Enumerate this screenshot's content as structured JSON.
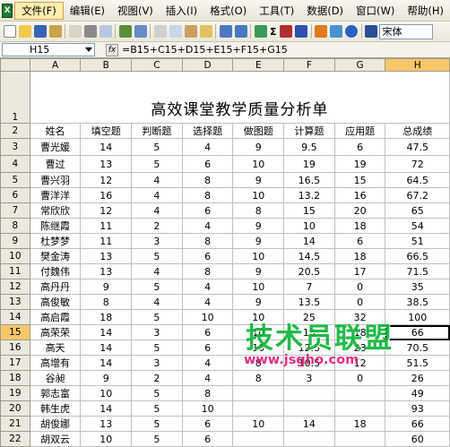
{
  "menubar": {
    "app_icon": "X",
    "items": [
      "文件(F)",
      "编辑(E)",
      "视图(V)",
      "插入(I)",
      "格式(O)",
      "工具(T)",
      "数据(D)",
      "窗口(W)",
      "帮助(H)"
    ]
  },
  "toolbar": {
    "sigma": "Σ",
    "font_name": "宋体",
    "icons": [
      "new-icon",
      "open-icon",
      "save-icon",
      "permission-icon",
      "email-icon",
      "print-icon",
      "print-preview-icon",
      "spelling-icon",
      "research-icon",
      "cut-icon",
      "copy-icon",
      "paste-icon",
      "format-painter-icon",
      "undo-icon",
      "redo-icon",
      "hyperlink-icon",
      "autosum-icon",
      "sort-ascending-icon",
      "sort-descending-icon",
      "chart-wizard-icon",
      "drawing-icon",
      "zoom-icon",
      "help-icon"
    ]
  },
  "formulabar": {
    "cell_ref": "H15",
    "fx": "fx",
    "formula": "=B15+C15+D15+E15+F15+G15"
  },
  "sheet": {
    "columns": [
      "A",
      "B",
      "C",
      "D",
      "E",
      "F",
      "G",
      "H"
    ],
    "selected_column": "H",
    "selected_row": "15",
    "title": "高效课堂教学质量分析单",
    "headers": [
      "姓名",
      "填空题",
      "判断题",
      "选择题",
      "做图题",
      "计算题",
      "应用题",
      "总成绩"
    ],
    "rows": [
      {
        "num": "3",
        "cells": [
          "曹光媛",
          "14",
          "5",
          "4",
          "9",
          "9.5",
          "6",
          "47.5"
        ]
      },
      {
        "num": "4",
        "cells": [
          "曹过",
          "13",
          "5",
          "6",
          "10",
          "19",
          "19",
          "72"
        ]
      },
      {
        "num": "5",
        "cells": [
          "曹兴羽",
          "12",
          "4",
          "8",
          "9",
          "16.5",
          "15",
          "64.5"
        ]
      },
      {
        "num": "6",
        "cells": [
          "曹洋洋",
          "16",
          "4",
          "8",
          "10",
          "13.2",
          "16",
          "67.2"
        ]
      },
      {
        "num": "7",
        "cells": [
          "常欣欣",
          "12",
          "4",
          "6",
          "8",
          "15",
          "20",
          "65"
        ]
      },
      {
        "num": "8",
        "cells": [
          "陈继霞",
          "11",
          "2",
          "4",
          "9",
          "10",
          "18",
          "54"
        ]
      },
      {
        "num": "9",
        "cells": [
          "杜梦梦",
          "11",
          "3",
          "8",
          "9",
          "14",
          "6",
          "51"
        ]
      },
      {
        "num": "10",
        "cells": [
          "樊金涛",
          "13",
          "5",
          "6",
          "10",
          "14.5",
          "18",
          "66.5"
        ]
      },
      {
        "num": "11",
        "cells": [
          "付魏伟",
          "13",
          "4",
          "8",
          "9",
          "20.5",
          "17",
          "71.5"
        ]
      },
      {
        "num": "12",
        "cells": [
          "高丹丹",
          "9",
          "5",
          "4",
          "10",
          "7",
          "0",
          "35"
        ]
      },
      {
        "num": "13",
        "cells": [
          "高俊敏",
          "8",
          "4",
          "4",
          "9",
          "13.5",
          "0",
          "38.5"
        ]
      },
      {
        "num": "14",
        "cells": [
          "高启霞",
          "18",
          "5",
          "10",
          "10",
          "25",
          "32",
          "100"
        ]
      },
      {
        "num": "15",
        "cells": [
          "高荣荣",
          "14",
          "3",
          "6",
          "10",
          "15",
          "18",
          "66"
        ]
      },
      {
        "num": "16",
        "cells": [
          "高天",
          "14",
          "5",
          "6",
          "10",
          "12.5",
          "23",
          "70.5"
        ]
      },
      {
        "num": "17",
        "cells": [
          "高增有",
          "14",
          "3",
          "4",
          "8",
          "10.5",
          "12",
          "51.5"
        ]
      },
      {
        "num": "18",
        "cells": [
          "谷昶",
          "9",
          "2",
          "4",
          "8",
          "3",
          "0",
          "26"
        ]
      },
      {
        "num": "19",
        "cells": [
          "郭志富",
          "10",
          "5",
          "8",
          "",
          "",
          "",
          "49"
        ]
      },
      {
        "num": "20",
        "cells": [
          "韩生虎",
          "14",
          "5",
          "10",
          "",
          "",
          "",
          "93"
        ]
      },
      {
        "num": "21",
        "cells": [
          "胡俊娜",
          "13",
          "5",
          "6",
          "10",
          "14",
          "18",
          "66"
        ]
      },
      {
        "num": "22",
        "cells": [
          "胡双云",
          "10",
          "5",
          "6",
          "",
          "",
          "",
          "60"
        ]
      }
    ]
  },
  "watermark": {
    "big": "技术员联盟",
    "url": "www.jsgho.com"
  }
}
